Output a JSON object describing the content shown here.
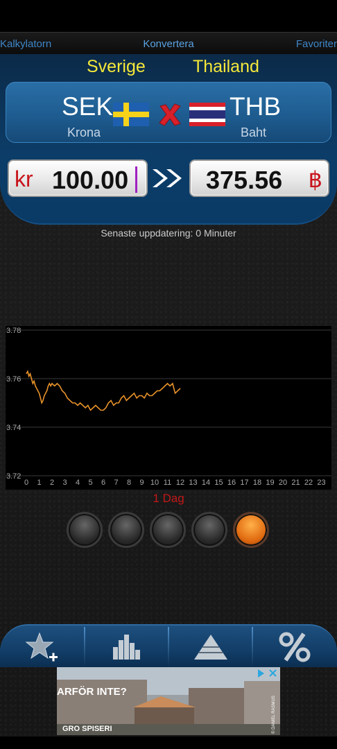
{
  "nav": {
    "left": "Kalkylatorn",
    "center": "Konvertera",
    "right": "Favoriter"
  },
  "countries": {
    "from": "Sverige",
    "to": "Thailand"
  },
  "currency": {
    "from_code": "SEK",
    "from_name": "Krona",
    "to_code": "THB",
    "to_name": "Baht"
  },
  "amount": {
    "from_symbol": "kr",
    "from_value": "100.00",
    "to_value": "375.56",
    "to_symbol": "฿"
  },
  "updated": "Senaste uppdatering: 0 Minuter",
  "period_label": "1 Dag",
  "period_options": 5,
  "period_active": 4,
  "ad": {
    "headline": "ARFÖR INTE?",
    "brand": "GRO SPISERI",
    "credit": "© DANIEL RASMUS"
  },
  "colors": {
    "accent_yellow": "#f5e83a",
    "line": "#e8922a",
    "red": "#c41818",
    "blue": "#3e86c8"
  },
  "chart_data": {
    "type": "line",
    "x_ticks": [
      "0",
      "1",
      "2",
      "3",
      "4",
      "5",
      "6",
      "7",
      "8",
      "9",
      "10",
      "11",
      "12",
      "13",
      "14",
      "15",
      "16",
      "17",
      "18",
      "19",
      "20",
      "21",
      "22",
      "23"
    ],
    "y_ticks": [
      "3.78",
      "3.76",
      "3.74",
      "3.72"
    ],
    "ylim": [
      3.72,
      3.78
    ],
    "xlim": [
      0,
      24
    ],
    "grid": true,
    "series": [
      {
        "x": [
          0,
          0.1,
          0.2,
          0.3,
          0.4,
          0.5,
          0.6,
          0.7,
          0.8,
          0.9,
          1.0,
          1.1,
          1.2,
          1.3,
          1.4,
          1.5,
          1.6,
          1.7,
          1.8,
          1.9,
          2.0,
          2.2,
          2.4,
          2.6,
          2.8,
          3.0,
          3.2,
          3.4,
          3.6,
          3.8,
          4.0,
          4.2,
          4.4,
          4.6,
          4.8,
          5.0,
          5.2,
          5.4,
          5.6,
          5.8,
          6.0,
          6.2,
          6.4,
          6.6,
          6.8,
          7.0,
          7.2,
          7.4,
          7.6,
          7.8,
          8.0,
          8.2,
          8.4,
          8.6,
          8.8,
          9.0,
          9.2,
          9.4,
          9.6,
          9.8,
          10.0,
          10.2,
          10.4,
          10.6,
          10.8,
          11.0,
          11.2,
          11.4,
          11.6,
          11.8,
          12.0
        ],
        "y": [
          3.762,
          3.763,
          3.761,
          3.762,
          3.76,
          3.758,
          3.759,
          3.757,
          3.756,
          3.755,
          3.754,
          3.752,
          3.75,
          3.751,
          3.753,
          3.754,
          3.755,
          3.757,
          3.758,
          3.757,
          3.758,
          3.757,
          3.758,
          3.757,
          3.755,
          3.754,
          3.752,
          3.751,
          3.75,
          3.75,
          3.749,
          3.75,
          3.749,
          3.748,
          3.749,
          3.747,
          3.748,
          3.749,
          3.748,
          3.747,
          3.747,
          3.748,
          3.75,
          3.751,
          3.749,
          3.75,
          3.75,
          3.752,
          3.753,
          3.751,
          3.752,
          3.753,
          3.754,
          3.752,
          3.753,
          3.753,
          3.752,
          3.754,
          3.753,
          3.753,
          3.754,
          3.755,
          3.755,
          3.756,
          3.757,
          3.758,
          3.757,
          3.758,
          3.754,
          3.755,
          3.756
        ]
      }
    ]
  }
}
